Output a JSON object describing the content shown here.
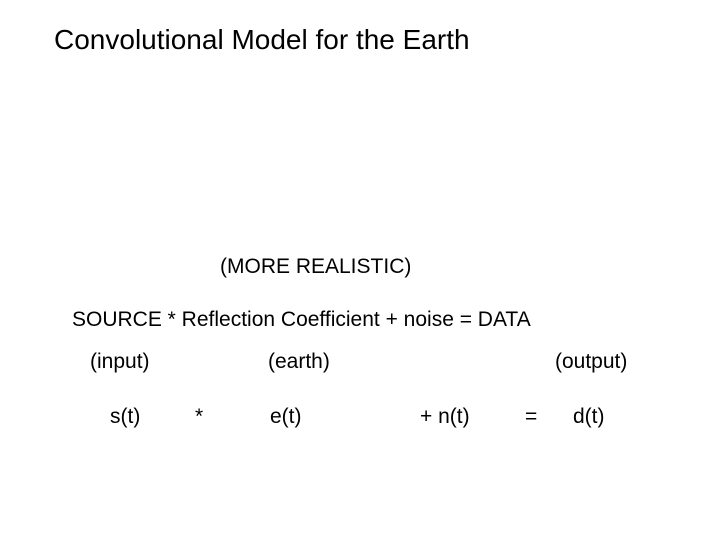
{
  "title": "Convolutional Model for the Earth",
  "subtitle": "(MORE REALISTIC)",
  "equation_text": "SOURCE *  Reflection Coefficient + noise  = DATA",
  "labels": {
    "input": "(input)",
    "earth": "(earth)",
    "output": "(output)"
  },
  "symbols": {
    "s": "s(t)",
    "ast": "*",
    "e": "e(t)",
    "n": "+ n(t)",
    "eq": "=",
    "d": "d(t)"
  }
}
